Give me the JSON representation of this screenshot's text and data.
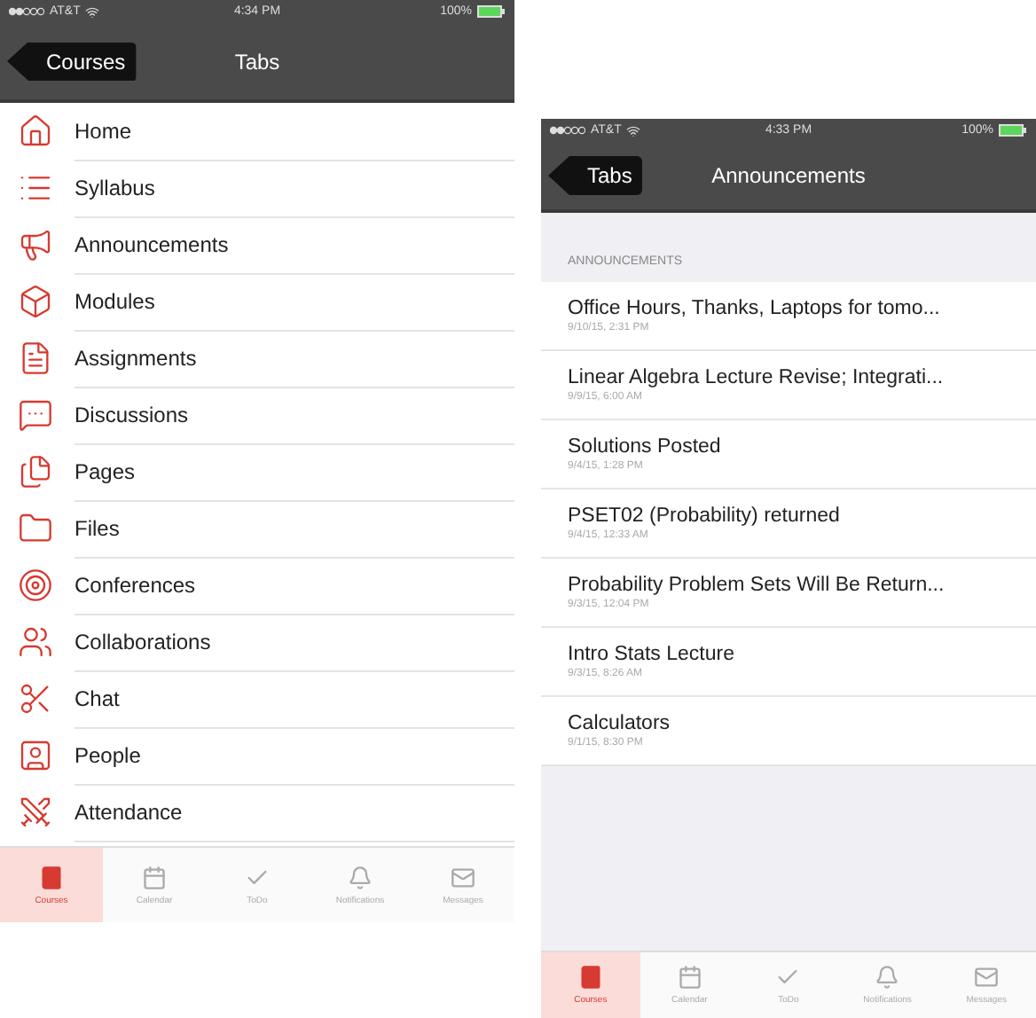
{
  "left_screen": {
    "status_bar": {
      "carrier": "AT&T",
      "time": "4:34 PM",
      "battery": "100%"
    },
    "nav_bar": {
      "back": "Courses",
      "title": "Tabs"
    },
    "items": [
      {
        "label": "Home"
      },
      {
        "label": "Syllabus"
      },
      {
        "label": "Announcements"
      },
      {
        "label": "Modules"
      },
      {
        "label": "Assignments"
      },
      {
        "label": "Discussions"
      },
      {
        "label": "Pages"
      },
      {
        "label": "Files"
      },
      {
        "label": "Conferences"
      },
      {
        "label": "Collaborations"
      },
      {
        "label": "Chat"
      },
      {
        "label": "People"
      },
      {
        "label": "Attendance"
      }
    ],
    "tab_bar": [
      {
        "label": "Courses",
        "selected": true
      },
      {
        "label": "Calendar",
        "selected": false
      },
      {
        "label": "ToDo",
        "selected": false
      },
      {
        "label": "Notifications",
        "selected": false
      },
      {
        "label": "Messages",
        "selected": false
      }
    ]
  },
  "right_screen": {
    "status_bar": {
      "carrier": "AT&T",
      "time": "4:33 PM",
      "battery": "100%"
    },
    "nav_bar": {
      "back": "Tabs",
      "title": "Announcements"
    },
    "section_header": "ANNOUNCEMENTS",
    "announcements": [
      {
        "title": "Office Hours, Thanks, Laptops for tomo...",
        "date": "9/10/15, 2:31 PM"
      },
      {
        "title": "Linear Algebra Lecture Revise; Integrati...",
        "date": "9/9/15, 6:00 AM"
      },
      {
        "title": "Solutions Posted",
        "date": "9/4/15, 1:28 PM"
      },
      {
        "title": "PSET02 (Probability) returned",
        "date": "9/4/15, 12:33 AM"
      },
      {
        "title": "Probability Problem Sets Will Be Return...",
        "date": "9/3/15, 12:04 PM"
      },
      {
        "title": "Intro Stats Lecture",
        "date": "9/3/15, 8:26 AM"
      },
      {
        "title": "Calculators",
        "date": "9/1/15, 8:30 PM"
      }
    ],
    "tab_bar": [
      {
        "label": "Courses",
        "selected": true
      },
      {
        "label": "Calendar",
        "selected": false
      },
      {
        "label": "ToDo",
        "selected": false
      },
      {
        "label": "Notifications",
        "selected": false
      },
      {
        "label": "Messages",
        "selected": false
      }
    ]
  }
}
